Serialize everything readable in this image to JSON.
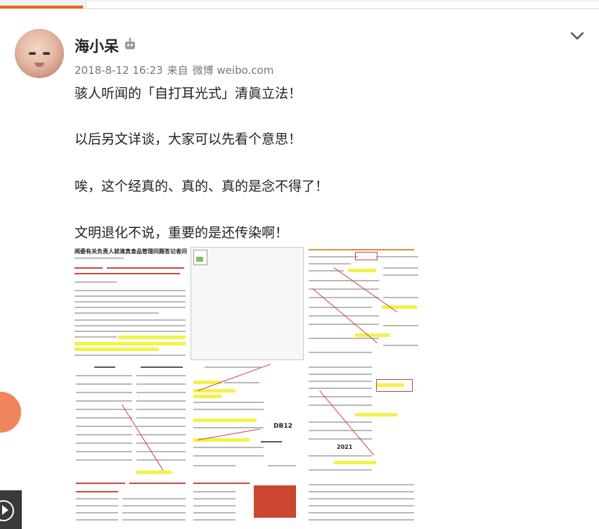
{
  "post": {
    "author": "海小呆",
    "timestamp": "2018-8-12 16:23",
    "source_prefix": "来自",
    "source": "微博 weibo.com",
    "lines": [
      "骇人听闻的「自打耳光式」清眞立法！",
      "以后另文详谈，大家可以先看个意思！",
      "唉，这个经真的、真的、真的是念不得了！",
      "文明退化不说，重要的是还传染啊！"
    ]
  },
  "images": {
    "thumb1_title": "闻委有关负责人就清真食品管理问题答记者问",
    "thumb8_title": "DB12",
    "thumb10_title": "2021"
  },
  "icons": {
    "badge": "robot-icon",
    "menu": "chevron-down-icon",
    "play": "play-icon"
  },
  "colors": {
    "accent": "#e8641b",
    "highlight": "#f2f24a",
    "annotation": "#d23c3c"
  }
}
